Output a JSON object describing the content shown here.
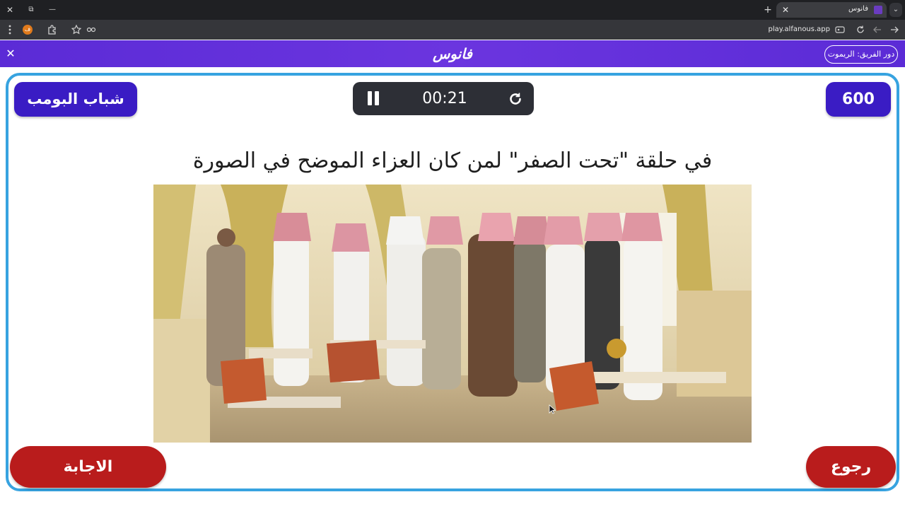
{
  "browser": {
    "tab_title": "فانوس",
    "url": "play.alfanous.app",
    "window_controls": {
      "close": "✕",
      "restore": "⧉",
      "minimize": "—"
    },
    "tab_close": "✕",
    "new_tab": "+",
    "tab_menu": "⌄",
    "extension_badge": "ف",
    "icons": [
      "menu-dots-icon",
      "extension-icon",
      "puzzle-icon",
      "star-icon",
      "reading-icon",
      "site-settings-icon",
      "reload-icon",
      "back-icon",
      "forward-icon"
    ]
  },
  "site": {
    "close": "✕",
    "logo": "فانوس",
    "turn_label": "دور الفريق: الريموت"
  },
  "game": {
    "team_name": "شباب البومب",
    "score": "600",
    "timer": "00:21",
    "question": "في حلقة \"تحت الصفر\" لمن كان العزاء الموضح في الصورة",
    "answer_button": "الاجابة",
    "back_button": "رجوع"
  },
  "colors": {
    "header_purple": "#5b2bd6",
    "team_pill": "#3a1cc4",
    "frame_border": "#37a3e0",
    "action_red": "#b91c1c",
    "timer_bg": "#2d2f36"
  }
}
